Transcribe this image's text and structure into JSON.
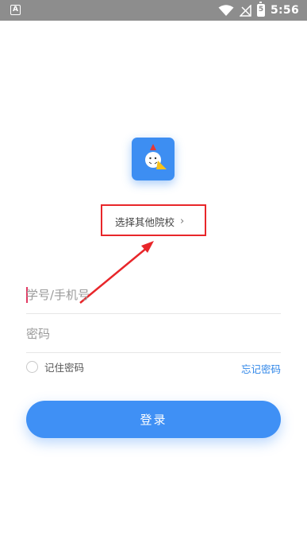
{
  "status_bar": {
    "time": "5:56",
    "battery_level": "5",
    "icons": [
      "app-notification-icon",
      "wifi-icon",
      "no-signal-icon",
      "battery-icon"
    ]
  },
  "app": {
    "logo_icon": "chick-mascot-icon",
    "brand_color": "#3d8ef2"
  },
  "school": {
    "label": "选择其他院校",
    "chevron": "›",
    "highlight_color": "#e8262a"
  },
  "form": {
    "username_placeholder": "学号/手机号",
    "password_placeholder": "密码",
    "remember_label": "记住密码",
    "forgot_label": "忘记密码",
    "login_label": "登录"
  }
}
